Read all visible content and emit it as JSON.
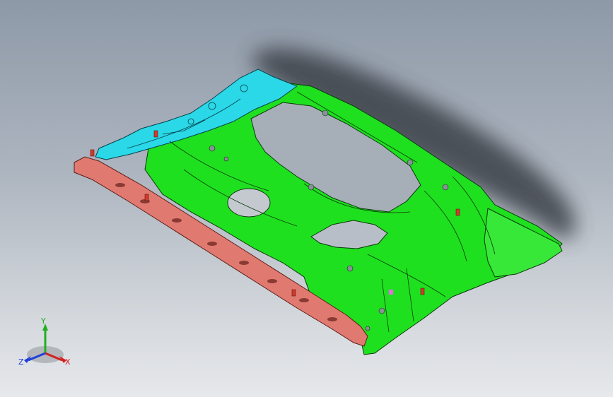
{
  "viewport": {
    "background_top": "#8e99a8",
    "background_bottom": "#e6e8eb"
  },
  "model": {
    "colors": {
      "green_panel": "#1fe01f",
      "cyan_panel": "#2ad8e8",
      "red_rail": "#e07a70",
      "edge": "#0a3a0a",
      "shadow": "#3a3f46",
      "fastener": "#d23a2a",
      "marker": "#ee66ee"
    }
  },
  "triad": {
    "x_label": "X",
    "y_label": "Y",
    "z_label": "Z",
    "x_color": "#d42020",
    "y_color": "#20b020",
    "z_color": "#2040d8"
  }
}
